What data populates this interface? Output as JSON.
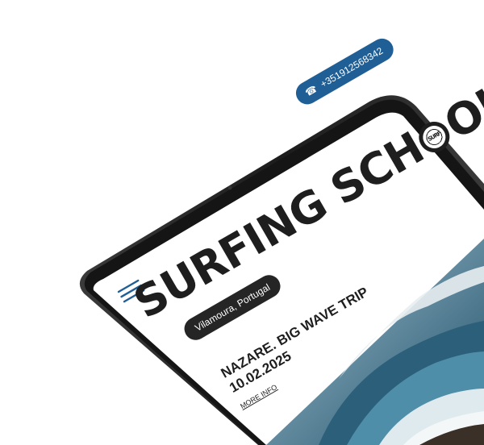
{
  "site": {
    "title_part1": "SURFING SCH",
    "title_part2": "OL",
    "logo_text": "SURF",
    "location": "Vilamoura, Portugal",
    "phone": "+351912568342"
  },
  "event": {
    "title": "NAZARE. BIG WAVE TRIP",
    "date": "10.02.2025",
    "link_label": "MORE INFO"
  },
  "icons": {
    "menu": "hamburger-icon",
    "phone": "phone-icon",
    "logo": "surf-seal-logo"
  },
  "colors": {
    "accent_blue": "#1f5f96",
    "pill_dark": "#252525",
    "text": "#1e1e1e",
    "device_frame": "#2b2b2b"
  }
}
